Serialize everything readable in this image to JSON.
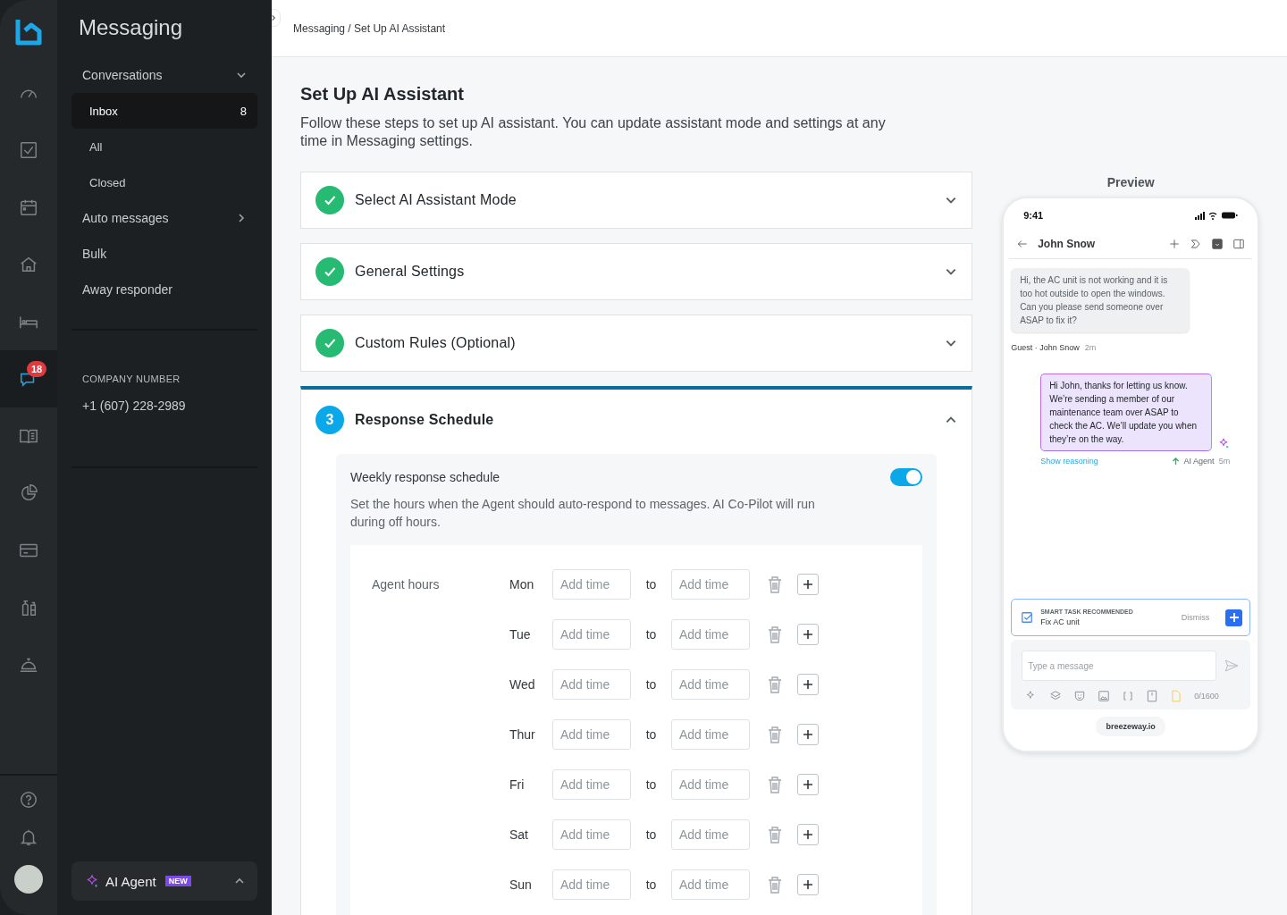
{
  "rail": {
    "items": [
      {
        "selected": false
      },
      {
        "selected": false
      },
      {
        "selected": false
      },
      {
        "selected": false
      },
      {
        "selected": false
      },
      {
        "selected": true,
        "badge": "18"
      },
      {
        "selected": false
      },
      {
        "selected": false
      },
      {
        "selected": false
      },
      {
        "selected": false
      },
      {
        "selected": false
      }
    ]
  },
  "nav": {
    "title": "Messaging",
    "items": [
      {
        "label": "Conversations",
        "expanded": true,
        "children": [
          {
            "label": "Inbox",
            "count": "8",
            "selected": true
          },
          {
            "label": "All",
            "selected": false
          },
          {
            "label": "Closed",
            "selected": false
          }
        ]
      },
      {
        "label": "Auto messages",
        "expanded": false
      },
      {
        "label": "Bulk"
      },
      {
        "label": "Away responder"
      }
    ],
    "company": {
      "label": "COMPANY NUMBER",
      "value": "+1 (607) 228-2989"
    },
    "ai_agent": {
      "label": "AI Agent",
      "badge": "NEW",
      "expanded": false
    }
  },
  "breadcrumb": "Messaging / Set Up AI Assistant",
  "heading": "Set Up AI Assistant",
  "intro": "Follow these steps to set up AI assistant. You can update assistant mode and settings at any time in Messaging settings.",
  "steps": [
    {
      "title": "Select AI Assistant Mode",
      "done": true,
      "expanded": false
    },
    {
      "title": "General Settings",
      "done": true,
      "expanded": false
    },
    {
      "title": "Custom Rules (Optional)",
      "done": true,
      "expanded": false
    },
    {
      "title": "Response Schedule",
      "done": false,
      "number": "3",
      "expanded": true
    }
  ],
  "schedule": {
    "title": "Weekly response schedule",
    "on": true,
    "description": "Set the hours when the Agent should auto-respond to messages. AI Co-Pilot will run during off hours.",
    "hours_label": "Agent hours",
    "days": [
      {
        "day": "Mon",
        "from": {
          "placeholder": "Add time"
        },
        "to": "to",
        "until": {
          "placeholder": "Add time"
        }
      },
      {
        "day": "Tue",
        "from": {
          "placeholder": "Add time"
        },
        "to": "to",
        "until": {
          "placeholder": "Add time"
        }
      },
      {
        "day": "Wed",
        "from": {
          "placeholder": "Add time"
        },
        "to": "to",
        "until": {
          "placeholder": "Add time"
        }
      },
      {
        "day": "Thur",
        "from": {
          "placeholder": "Add time"
        },
        "to": "to",
        "until": {
          "placeholder": "Add time"
        }
      },
      {
        "day": "Fri",
        "from": {
          "placeholder": "Add time"
        },
        "to": "to",
        "until": {
          "placeholder": "Add time"
        }
      },
      {
        "day": "Sat",
        "from": {
          "placeholder": "Add time"
        },
        "to": "to",
        "until": {
          "placeholder": "Add time"
        }
      },
      {
        "day": "Sun",
        "from": {
          "placeholder": "Add time"
        },
        "to": "to",
        "until": {
          "placeholder": "Add time"
        }
      }
    ]
  },
  "preview": {
    "label": "Preview",
    "time": "9:41",
    "contact": "John Snow",
    "guest_message": {
      "text": "Hi, the AC unit is not working and it is too hot outside to open the windows. Can you please send someone over ASAP to fix it?",
      "sender": "Guest · John Snow",
      "age": "2m"
    },
    "agent_message": {
      "text": "Hi John, thanks for letting us know. We’re sending a member of our maintenance team over ASAP to check the AC. We’ll update you when they’re on the way.",
      "link": "Show reasoning",
      "sender": "AI Agent",
      "age": "5m"
    },
    "smart_task": {
      "label": "SMART TASK RECOMMENDED",
      "title": "Fix AC unit",
      "dismiss": "Dismiss"
    },
    "composer": {
      "placeholder": "Type a message",
      "counter": "0/1600"
    },
    "url": "breezeway.io"
  }
}
